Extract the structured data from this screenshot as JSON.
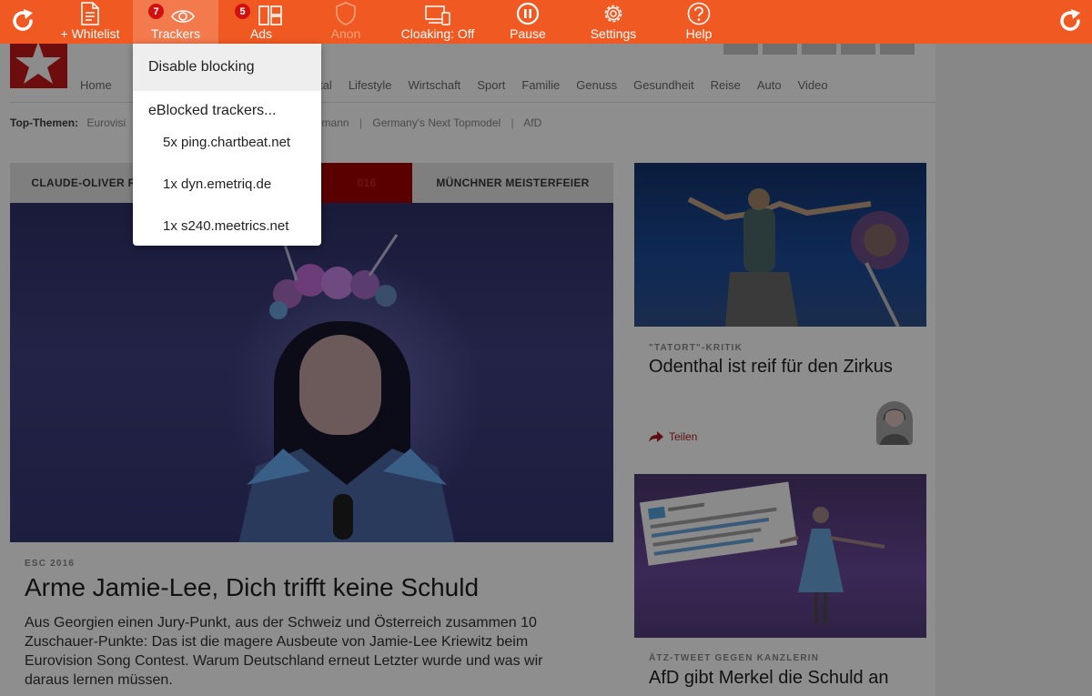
{
  "toolbar": {
    "whitelist_label": "+ Whitelist",
    "trackers_label": "Trackers",
    "trackers_count": "7",
    "ads_label": "Ads",
    "ads_count": "5",
    "anon_label": "Anon",
    "cloaking_label": "Cloaking: Off",
    "pause_label": "Pause",
    "settings_label": "Settings",
    "help_label": "Help",
    "accent_color": "#f05a22",
    "badge_color": "#d11010"
  },
  "dropdown": {
    "disable_label": "Disable blocking",
    "heading": "eBlocked trackers...",
    "trackers": [
      "5x ping.chartbeat.net",
      "1x dyn.emetriq.de",
      "1x s240.meetrics.net"
    ]
  },
  "site": {
    "logo_text": "Stern",
    "nav": [
      "Home",
      "Digital",
      "Lifestyle",
      "Wirtschaft",
      "Sport",
      "Familie",
      "Genuss",
      "Gesundheit",
      "Reise",
      "Auto",
      "Video"
    ],
    "top_themen_label": "Top-Themen:",
    "top_themen": [
      "Eurovisi",
      "en Böhmermann",
      "Germany's Next Topmodel",
      "AfD"
    ],
    "tabs": [
      "CLAUDE-OLIVER R",
      "016",
      "MÜNCHNER MEISTERFEIER"
    ],
    "main_article": {
      "kicker": "ESC 2016",
      "headline": "Arme Jamie-Lee, Dich trifft keine Schuld",
      "teaser": "Aus Georgien einen Jury-Punkt, aus der Schweiz und Österreich zusammen 10 Zuschauer-Punkte: Das ist die magere Ausbeute von Jamie-Lee Kriewitz beim Eurovision Song Contest. Warum Deutschland erneut Letzter wurde und was wir daraus lernen müssen."
    },
    "side_articles": [
      {
        "kicker": "\"TATORT\"-KRITIK",
        "headline": "Odenthal ist reif für den Zirkus",
        "share": "Teilen"
      },
      {
        "kicker": "ÄTZ-TWEET GEGEN KANZLERIN",
        "headline": "AfD gibt Merkel die Schuld an"
      }
    ]
  }
}
